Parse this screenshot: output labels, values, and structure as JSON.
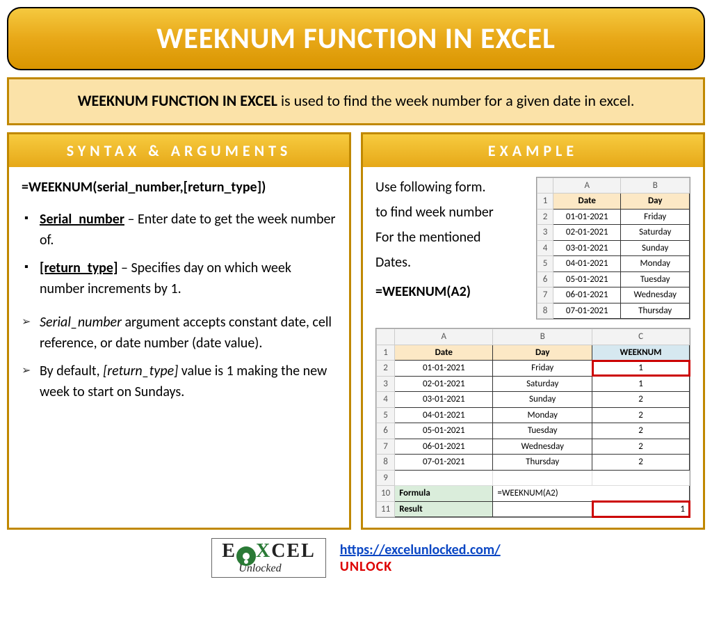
{
  "title": "WEEKNUM FUNCTION IN EXCEL",
  "description": {
    "bold": "WEEKNUM FUNCTION IN EXCEL",
    "rest": " is used to find the week number for a given date in excel."
  },
  "syntax": {
    "header": "SYNTAX & ARGUMENTS",
    "formula": "=WEEKNUM(serial_number,[return_type])",
    "args": [
      {
        "name": "Serial_number",
        "text": " – Enter date to get the week number of."
      },
      {
        "name": "[return_type]",
        "text": " – Specifies day on which week number increments by 1."
      }
    ],
    "notes": [
      {
        "it": "Serial_number",
        "text": " argument accepts constant date, cell reference, or date number (date value)."
      },
      {
        "prefix": "By default, ",
        "it": "[return_type]",
        "text": " value is 1 making the new week to start on Sundays."
      }
    ]
  },
  "example": {
    "header": "EXAMPLE",
    "lines": [
      "Use following form.",
      "to find week number",
      "For the mentioned",
      "Dates."
    ],
    "formula": "=WEEKNUM(A2)",
    "table1": {
      "cols": [
        "A",
        "B"
      ],
      "headers": [
        "Date",
        "Day"
      ],
      "rows": [
        [
          "01-01-2021",
          "Friday"
        ],
        [
          "02-01-2021",
          "Saturday"
        ],
        [
          "03-01-2021",
          "Sunday"
        ],
        [
          "04-01-2021",
          "Monday"
        ],
        [
          "05-01-2021",
          "Tuesday"
        ],
        [
          "06-01-2021",
          "Wednesday"
        ],
        [
          "07-01-2021",
          "Thursday"
        ]
      ]
    },
    "table2": {
      "cols": [
        "A",
        "B",
        "C"
      ],
      "headers": [
        "Date",
        "Day",
        "WEEKNUM"
      ],
      "rows": [
        [
          "01-01-2021",
          "Friday",
          "1"
        ],
        [
          "02-01-2021",
          "Saturday",
          "1"
        ],
        [
          "03-01-2021",
          "Sunday",
          "2"
        ],
        [
          "04-01-2021",
          "Monday",
          "2"
        ],
        [
          "05-01-2021",
          "Tuesday",
          "2"
        ],
        [
          "06-01-2021",
          "Wednesday",
          "2"
        ],
        [
          "07-01-2021",
          "Thursday",
          "2"
        ]
      ],
      "formula_row": {
        "label": "Formula",
        "value": "=WEEKNUM(A2)"
      },
      "result_row": {
        "label": "Result",
        "value": "1"
      }
    }
  },
  "footer": {
    "logo": {
      "e": "E",
      "x": "X",
      "cel": "CEL",
      "sub": "Unlocked"
    },
    "url": "https://excelunlocked.com/",
    "unlock": "UNLOCK"
  }
}
